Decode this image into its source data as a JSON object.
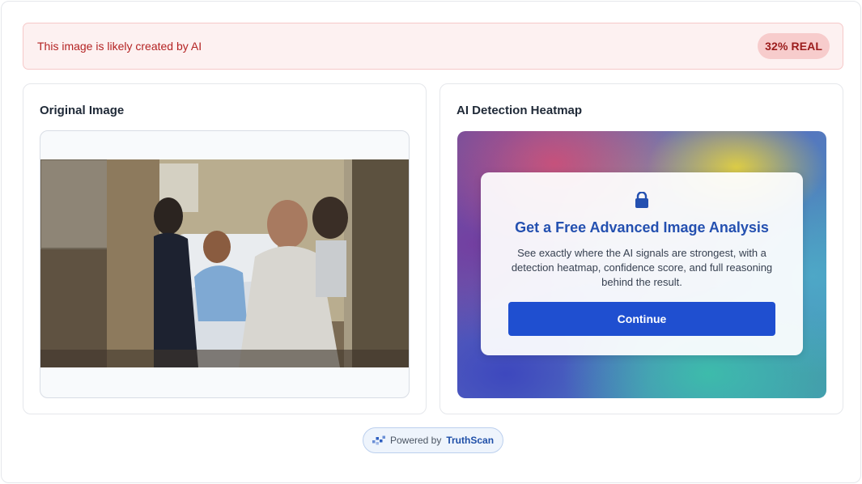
{
  "alert": {
    "message": "This image is likely created by AI",
    "badge": "32% REAL",
    "colors": {
      "background": "#fdf1f1",
      "text": "#b42323",
      "badge_bg": "#f7cccc"
    }
  },
  "original": {
    "title": "Original Image",
    "image_icon": "hospital-photo"
  },
  "heatmap": {
    "title": "AI Detection Heatmap",
    "lock_icon": "lock-icon",
    "promo_title": "Get a Free Advanced Image Analysis",
    "promo_text": "See exactly where the AI signals are strongest, with a detection heatmap, confidence score, and full reasoning behind the result.",
    "button_label": "Continue",
    "accent": "#1f4fd0"
  },
  "footer": {
    "powered_prefix": "Powered by",
    "brand": "TruthScan",
    "logo_icon": "truthscan-logo-icon"
  }
}
